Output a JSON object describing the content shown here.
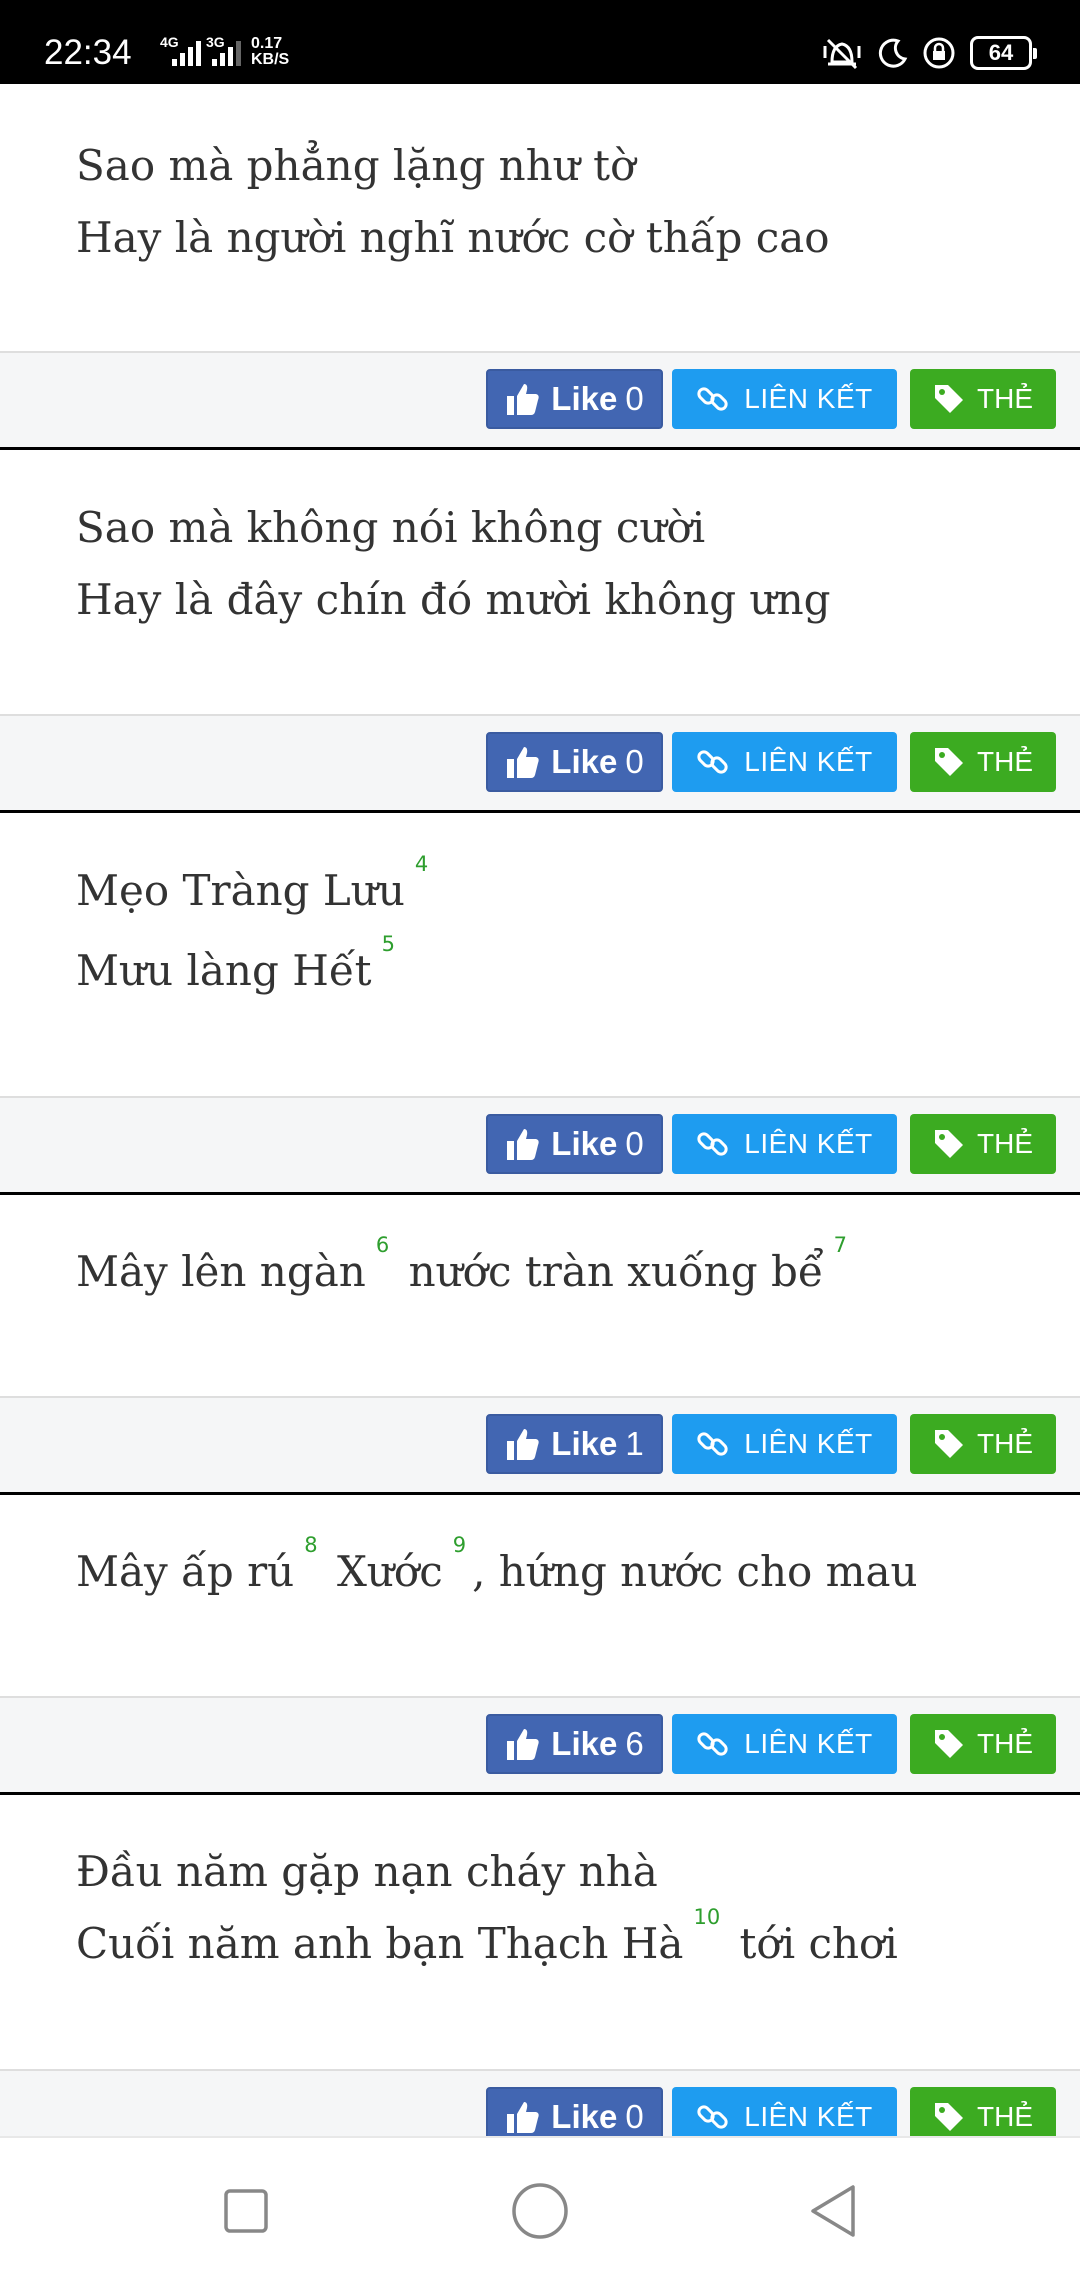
{
  "status_bar": {
    "time": "22:34",
    "network1": "4G",
    "network2": "3G",
    "speed_value": "0.17",
    "speed_unit": "KB/S",
    "battery": "64"
  },
  "verses": [
    {
      "lines": [
        [
          {
            "text": "Sao mà phẳng lặng như tờ"
          }
        ],
        [
          {
            "text": "Hay là người nghĩ nước cờ thấp cao"
          }
        ]
      ],
      "likes": "0"
    },
    {
      "lines": [
        [
          {
            "text": "Sao mà không nói không cười"
          }
        ],
        [
          {
            "text": "Hay là đây chín đó mười không ưng"
          }
        ]
      ],
      "likes": "0"
    },
    {
      "lines": [
        [
          {
            "text": "Mẹo Tràng Lưu"
          },
          {
            "sup": "4"
          }
        ],
        [
          {
            "text": "Mưu làng Hết"
          },
          {
            "sup": "5"
          }
        ]
      ],
      "likes": "0"
    },
    {
      "lines": [
        [
          {
            "text": "Mây lên ngàn"
          },
          {
            "sup": "6"
          },
          {
            "text": " nước tràn xuống bể"
          },
          {
            "sup": "7"
          }
        ]
      ],
      "likes": "1"
    },
    {
      "lines": [
        [
          {
            "text": "Mây ấp rú"
          },
          {
            "sup": "8"
          },
          {
            "text": " Xước"
          },
          {
            "sup": "9"
          },
          {
            "text": ", hứng nước cho mau"
          }
        ]
      ],
      "likes": "6"
    },
    {
      "lines": [
        [
          {
            "text": "Đầu năm gặp nạn cháy nhà"
          }
        ],
        [
          {
            "text": "Cuối năm anh bạn Thạch Hà"
          },
          {
            "sup": "10"
          },
          {
            "text": " tới chơi"
          }
        ]
      ],
      "likes": "0"
    }
  ],
  "buttons": {
    "like_label": "Like",
    "link_label": "LIÊN KẾT",
    "tag_label": "THẺ"
  },
  "icons": {
    "like": "thumbs-up-icon",
    "link": "link-icon",
    "tag": "tag-icon",
    "nav_recent": "square-icon",
    "nav_home": "circle-icon",
    "nav_back": "triangle-back-icon"
  },
  "colors": {
    "like_button": "#4266b2",
    "link_button": "#1e9cf0",
    "tag_button": "#3cab21",
    "footnote": "#2e9e2e",
    "verse_text": "#333333"
  }
}
